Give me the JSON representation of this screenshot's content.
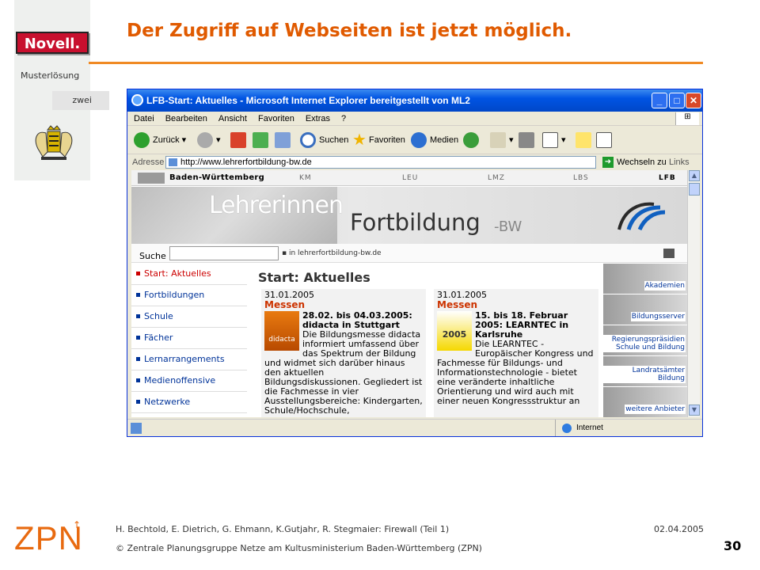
{
  "slide": {
    "title": "Der Zugriff auf Webseiten ist jetzt möglich.",
    "brand_badge": "Novell.",
    "section_label": "Musterlösung",
    "section_tag": "zwei",
    "page_number": "30",
    "footer": {
      "logo_text": "ZPN",
      "authors": "H. Bechtold, E. Dietrich, G. Ehmann, K.Gutjahr, R. Stegmaier: Firewall (Teil 1)",
      "date": "02.04.2005",
      "copyright": "© Zentrale Planungsgruppe Netze am Kultusministerium Baden-Württemberg (ZPN)"
    }
  },
  "browser": {
    "window_title": "LFB-Start: Aktuelles - Microsoft Internet Explorer bereitgestellt von ML2",
    "menu": [
      "Datei",
      "Bearbeiten",
      "Ansicht",
      "Favoriten",
      "Extras",
      "?"
    ],
    "toolbar": {
      "back": "Zurück",
      "search": "Suchen",
      "favorites": "Favoriten",
      "media": "Medien"
    },
    "address_label": "Adresse",
    "address_value": "http://www.lehrerfortbildung-bw.de",
    "go_label": "Wechseln zu",
    "links_label": "Links",
    "status_zone": "Internet"
  },
  "website": {
    "header_left": "Baden-Württemberg",
    "header_nav": [
      "KM",
      "LEU",
      "LMZ",
      "LBS",
      "LFB"
    ],
    "banner_top": "Lehrerinnen",
    "banner_main": "Fortbildung",
    "banner_suffix": "-BW",
    "search_label": "Suche",
    "search_scope": "in lehrerfortbildung-bw.de",
    "nav_items": [
      "Start: Aktuelles",
      "Fortbildungen",
      "Schule",
      "Fächer",
      "Lernarrangements",
      "Medienoffensive",
      "Netzwerke"
    ],
    "content_title": "Start: Aktuelles",
    "news": [
      {
        "date": "31.01.2005",
        "category": "Messen",
        "headline": "28.02. bis 04.03.2005: didacta in Stuttgart",
        "body": "Die Bildungsmesse didacta informiert umfassend über das Spektrum der Bildung und widmet sich darüber hinaus den aktuellen Bildungsdiskussionen. Gegliedert ist die Fachmesse in vier Ausstellungsbereiche: Kindergarten, Schule/Hochschule,",
        "thumb_text": "didacta"
      },
      {
        "date": "31.01.2005",
        "category": "Messen",
        "headline": "15. bis 18. Februar 2005: LEARNTEC in Karlsruhe",
        "body": "Die LEARNTEC - Europäischer Kongress und Fachmesse für Bildungs- und Informationstechnologie - bietet eine veränderte inhaltliche Orientierung und wird auch mit einer neuen Kongressstruktur an",
        "thumb_text": "2005"
      }
    ],
    "right_links": [
      "Akademien",
      "Bildungsserver",
      "Regierungspräsidien Schule und Bildung",
      "Landratsämter Bildung",
      "weitere Anbieter"
    ]
  },
  "colors": {
    "title_orange": "#e05a00",
    "novell_red": "#c8102e",
    "xp_blue": "#0054e3"
  }
}
